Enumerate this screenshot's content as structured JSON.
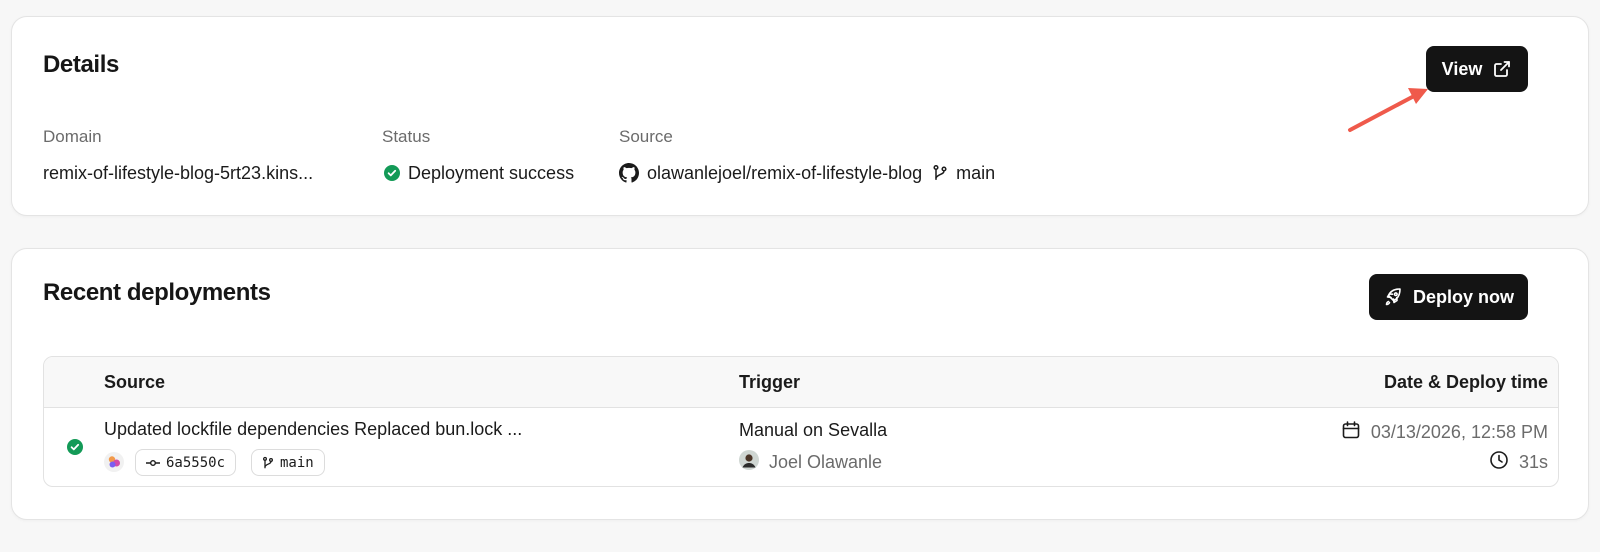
{
  "details": {
    "title": "Details",
    "view_button_label": "View",
    "domain_label": "Domain",
    "domain_value": "remix-of-lifestyle-blog-5rt23.kins...",
    "status_label": "Status",
    "status_value": "Deployment success",
    "source_label": "Source",
    "source_repo": "olawanlejoel/remix-of-lifestyle-blog",
    "source_branch": "main"
  },
  "deployments": {
    "title": "Recent deployments",
    "deploy_button_label": "Deploy now",
    "columns": {
      "source": "Source",
      "trigger": "Trigger",
      "date": "Date & Deploy time"
    },
    "rows": [
      {
        "commit_message": "Updated lockfile dependencies Replaced bun.lock ...",
        "commit_hash": "6a5550c",
        "branch": "main",
        "trigger": "Manual on Sevalla",
        "user": "Joel Olawanle",
        "date": "03/13/2026, 12:58 PM",
        "duration": "31s"
      }
    ]
  },
  "icons": {
    "view": "external-link-icon",
    "status": "check-circle-icon",
    "source": "github-icon",
    "branch": "git-branch-icon",
    "deploy": "rocket-icon",
    "commit": "git-commit-icon",
    "calendar": "calendar-icon",
    "clock": "clock-icon"
  },
  "colors": {
    "success": "#139a57",
    "button_bg": "#141414",
    "annotation_arrow": "#ef5a4b"
  }
}
